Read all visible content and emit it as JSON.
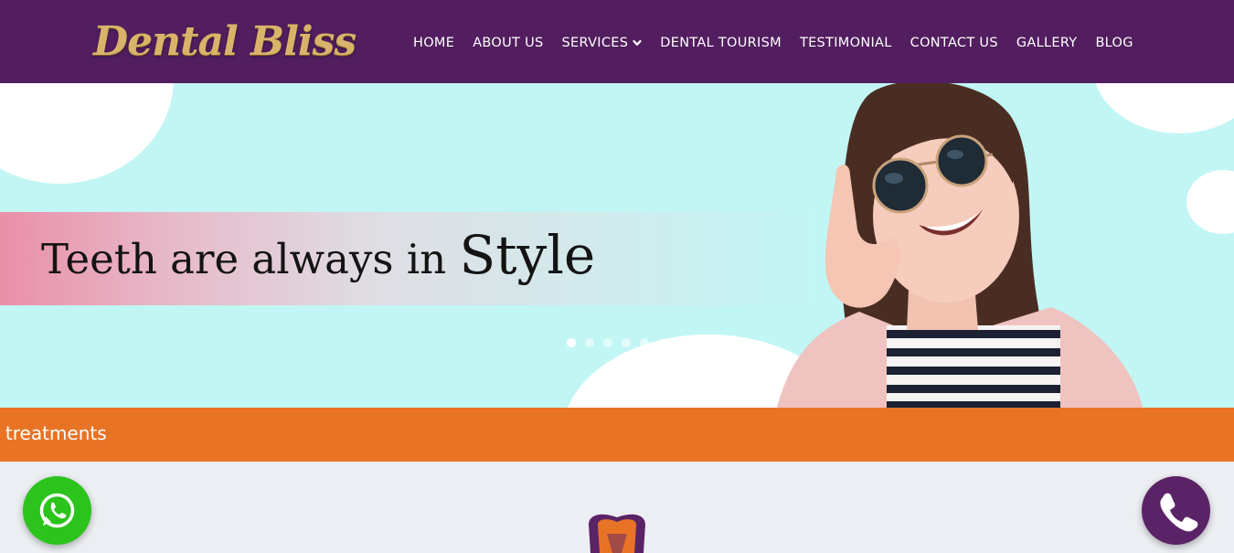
{
  "header": {
    "logo_text": "Dental Bliss",
    "nav": [
      {
        "label": "HOME"
      },
      {
        "label": "ABOUT US"
      },
      {
        "label": "SERVICES",
        "has_dropdown": true
      },
      {
        "label": "DENTAL TOURISM"
      },
      {
        "label": "TESTIMONIAL"
      },
      {
        "label": "CONTACT US"
      },
      {
        "label": "GALLERY"
      },
      {
        "label": "BLOG"
      }
    ]
  },
  "hero": {
    "headline_part1": "Teeth are always in",
    "headline_part2": "Style",
    "slide_count": 6,
    "active_slide": 1,
    "image": "smiling-woman-sunglasses"
  },
  "strip": {
    "marquee_text": "l treatments"
  },
  "floating": {
    "whatsapp_icon": "whatsapp-icon",
    "call_icon": "phone-icon"
  },
  "colors": {
    "header_bg": "#521e5f",
    "hero_bg": "#c2f6f5",
    "strip_bg": "#e97325",
    "whatsapp": "#2bc31c",
    "call": "#5b2367",
    "logo_gold": "#d9b36a"
  }
}
